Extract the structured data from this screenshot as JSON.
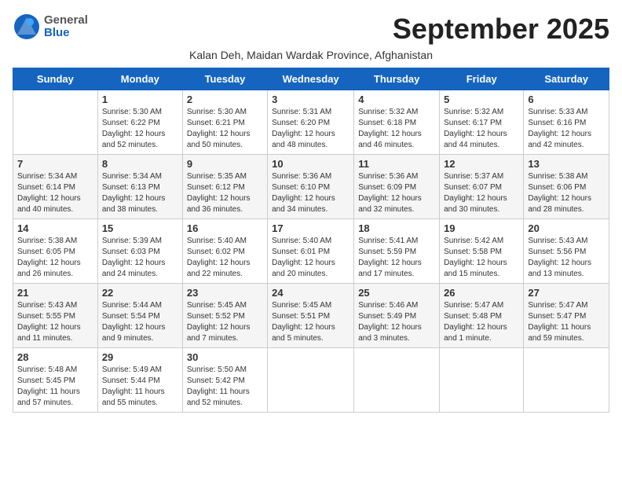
{
  "logo": {
    "general": "General",
    "blue": "Blue"
  },
  "title": "September 2025",
  "subtitle": "Kalan Deh, Maidan Wardak Province, Afghanistan",
  "days_of_week": [
    "Sunday",
    "Monday",
    "Tuesday",
    "Wednesday",
    "Thursday",
    "Friday",
    "Saturday"
  ],
  "weeks": [
    [
      {
        "day": "",
        "info": ""
      },
      {
        "day": "1",
        "info": "Sunrise: 5:30 AM\nSunset: 6:22 PM\nDaylight: 12 hours\nand 52 minutes."
      },
      {
        "day": "2",
        "info": "Sunrise: 5:30 AM\nSunset: 6:21 PM\nDaylight: 12 hours\nand 50 minutes."
      },
      {
        "day": "3",
        "info": "Sunrise: 5:31 AM\nSunset: 6:20 PM\nDaylight: 12 hours\nand 48 minutes."
      },
      {
        "day": "4",
        "info": "Sunrise: 5:32 AM\nSunset: 6:18 PM\nDaylight: 12 hours\nand 46 minutes."
      },
      {
        "day": "5",
        "info": "Sunrise: 5:32 AM\nSunset: 6:17 PM\nDaylight: 12 hours\nand 44 minutes."
      },
      {
        "day": "6",
        "info": "Sunrise: 5:33 AM\nSunset: 6:16 PM\nDaylight: 12 hours\nand 42 minutes."
      }
    ],
    [
      {
        "day": "7",
        "info": "Sunrise: 5:34 AM\nSunset: 6:14 PM\nDaylight: 12 hours\nand 40 minutes."
      },
      {
        "day": "8",
        "info": "Sunrise: 5:34 AM\nSunset: 6:13 PM\nDaylight: 12 hours\nand 38 minutes."
      },
      {
        "day": "9",
        "info": "Sunrise: 5:35 AM\nSunset: 6:12 PM\nDaylight: 12 hours\nand 36 minutes."
      },
      {
        "day": "10",
        "info": "Sunrise: 5:36 AM\nSunset: 6:10 PM\nDaylight: 12 hours\nand 34 minutes."
      },
      {
        "day": "11",
        "info": "Sunrise: 5:36 AM\nSunset: 6:09 PM\nDaylight: 12 hours\nand 32 minutes."
      },
      {
        "day": "12",
        "info": "Sunrise: 5:37 AM\nSunset: 6:07 PM\nDaylight: 12 hours\nand 30 minutes."
      },
      {
        "day": "13",
        "info": "Sunrise: 5:38 AM\nSunset: 6:06 PM\nDaylight: 12 hours\nand 28 minutes."
      }
    ],
    [
      {
        "day": "14",
        "info": "Sunrise: 5:38 AM\nSunset: 6:05 PM\nDaylight: 12 hours\nand 26 minutes."
      },
      {
        "day": "15",
        "info": "Sunrise: 5:39 AM\nSunset: 6:03 PM\nDaylight: 12 hours\nand 24 minutes."
      },
      {
        "day": "16",
        "info": "Sunrise: 5:40 AM\nSunset: 6:02 PM\nDaylight: 12 hours\nand 22 minutes."
      },
      {
        "day": "17",
        "info": "Sunrise: 5:40 AM\nSunset: 6:01 PM\nDaylight: 12 hours\nand 20 minutes."
      },
      {
        "day": "18",
        "info": "Sunrise: 5:41 AM\nSunset: 5:59 PM\nDaylight: 12 hours\nand 17 minutes."
      },
      {
        "day": "19",
        "info": "Sunrise: 5:42 AM\nSunset: 5:58 PM\nDaylight: 12 hours\nand 15 minutes."
      },
      {
        "day": "20",
        "info": "Sunrise: 5:43 AM\nSunset: 5:56 PM\nDaylight: 12 hours\nand 13 minutes."
      }
    ],
    [
      {
        "day": "21",
        "info": "Sunrise: 5:43 AM\nSunset: 5:55 PM\nDaylight: 12 hours\nand 11 minutes."
      },
      {
        "day": "22",
        "info": "Sunrise: 5:44 AM\nSunset: 5:54 PM\nDaylight: 12 hours\nand 9 minutes."
      },
      {
        "day": "23",
        "info": "Sunrise: 5:45 AM\nSunset: 5:52 PM\nDaylight: 12 hours\nand 7 minutes."
      },
      {
        "day": "24",
        "info": "Sunrise: 5:45 AM\nSunset: 5:51 PM\nDaylight: 12 hours\nand 5 minutes."
      },
      {
        "day": "25",
        "info": "Sunrise: 5:46 AM\nSunset: 5:49 PM\nDaylight: 12 hours\nand 3 minutes."
      },
      {
        "day": "26",
        "info": "Sunrise: 5:47 AM\nSunset: 5:48 PM\nDaylight: 12 hours\nand 1 minute."
      },
      {
        "day": "27",
        "info": "Sunrise: 5:47 AM\nSunset: 5:47 PM\nDaylight: 11 hours\nand 59 minutes."
      }
    ],
    [
      {
        "day": "28",
        "info": "Sunrise: 5:48 AM\nSunset: 5:45 PM\nDaylight: 11 hours\nand 57 minutes."
      },
      {
        "day": "29",
        "info": "Sunrise: 5:49 AM\nSunset: 5:44 PM\nDaylight: 11 hours\nand 55 minutes."
      },
      {
        "day": "30",
        "info": "Sunrise: 5:50 AM\nSunset: 5:42 PM\nDaylight: 11 hours\nand 52 minutes."
      },
      {
        "day": "",
        "info": ""
      },
      {
        "day": "",
        "info": ""
      },
      {
        "day": "",
        "info": ""
      },
      {
        "day": "",
        "info": ""
      }
    ]
  ]
}
